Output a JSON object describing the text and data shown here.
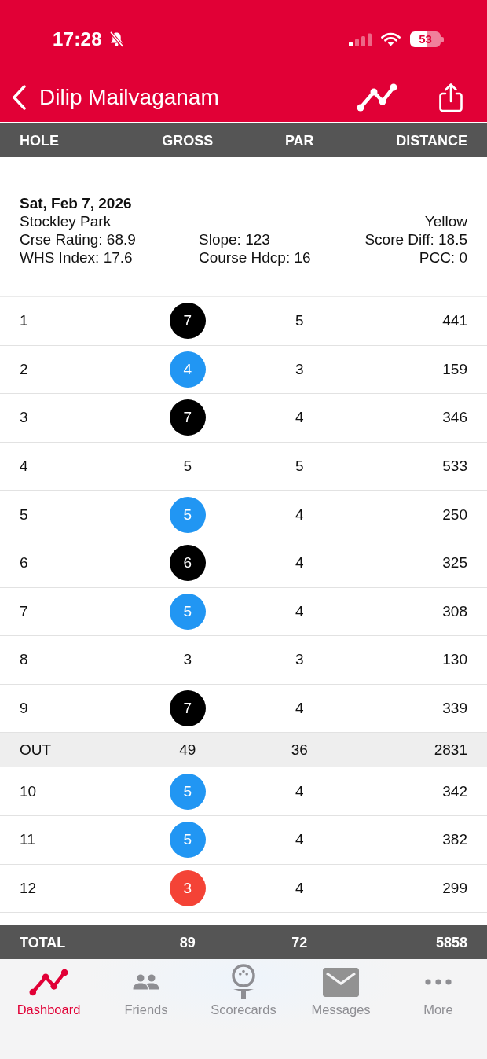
{
  "status_bar": {
    "time": "17:28",
    "battery": "53"
  },
  "nav_bar": {
    "title": "Dilip Mailvaganam"
  },
  "columns": [
    "HOLE",
    "GROSS",
    "PAR",
    "DISTANCE"
  ],
  "round_info": {
    "date": "Sat, Feb 7, 2026",
    "course": "Stockley Park",
    "tee": "Yellow",
    "stats": [
      [
        "Crse Rating: 68.9",
        "Slope: 123",
        "Score Diff: 18.5"
      ],
      [
        "WHS Index: 17.6",
        "Course Hdcp: 16",
        "PCC: 0"
      ]
    ]
  },
  "front_nine": [
    {
      "hole": "1",
      "gross": "7",
      "color": "#000000",
      "par": "5",
      "distance": "441"
    },
    {
      "hole": "2",
      "gross": "4",
      "color": "#2196f3",
      "par": "3",
      "distance": "159"
    },
    {
      "hole": "3",
      "gross": "7",
      "color": "#000000",
      "par": "4",
      "distance": "346"
    },
    {
      "hole": "4",
      "gross": "5",
      "par": "5",
      "distance": "533"
    },
    {
      "hole": "5",
      "gross": "5",
      "color": "#2196f3",
      "par": "4",
      "distance": "250"
    },
    {
      "hole": "6",
      "gross": "6",
      "color": "#000000",
      "par": "4",
      "distance": "325"
    },
    {
      "hole": "7",
      "gross": "5",
      "color": "#2196f3",
      "par": "4",
      "distance": "308"
    },
    {
      "hole": "8",
      "gross": "3",
      "par": "3",
      "distance": "130"
    },
    {
      "hole": "9",
      "gross": "7",
      "color": "#000000",
      "par": "4",
      "distance": "339"
    }
  ],
  "out_row": {
    "label": "OUT",
    "gross": "49",
    "par": "36",
    "distance": "2831"
  },
  "back_nine": [
    {
      "hole": "10",
      "gross": "5",
      "color": "#2196f3",
      "par": "4",
      "distance": "342"
    },
    {
      "hole": "11",
      "gross": "5",
      "color": "#2196f3",
      "par": "4",
      "distance": "382"
    },
    {
      "hole": "12",
      "gross": "3",
      "color": "#f44336",
      "par": "4",
      "distance": "299"
    }
  ],
  "total_row": {
    "label": "TOTAL",
    "gross": "89",
    "par": "72",
    "distance": "5858"
  },
  "tabs": [
    {
      "label": "Dashboard",
      "selected": true
    },
    {
      "label": "Friends",
      "selected": false
    },
    {
      "label": "Scorecards",
      "selected": false
    },
    {
      "label": "Messages",
      "selected": false
    },
    {
      "label": "More",
      "selected": false
    }
  ]
}
